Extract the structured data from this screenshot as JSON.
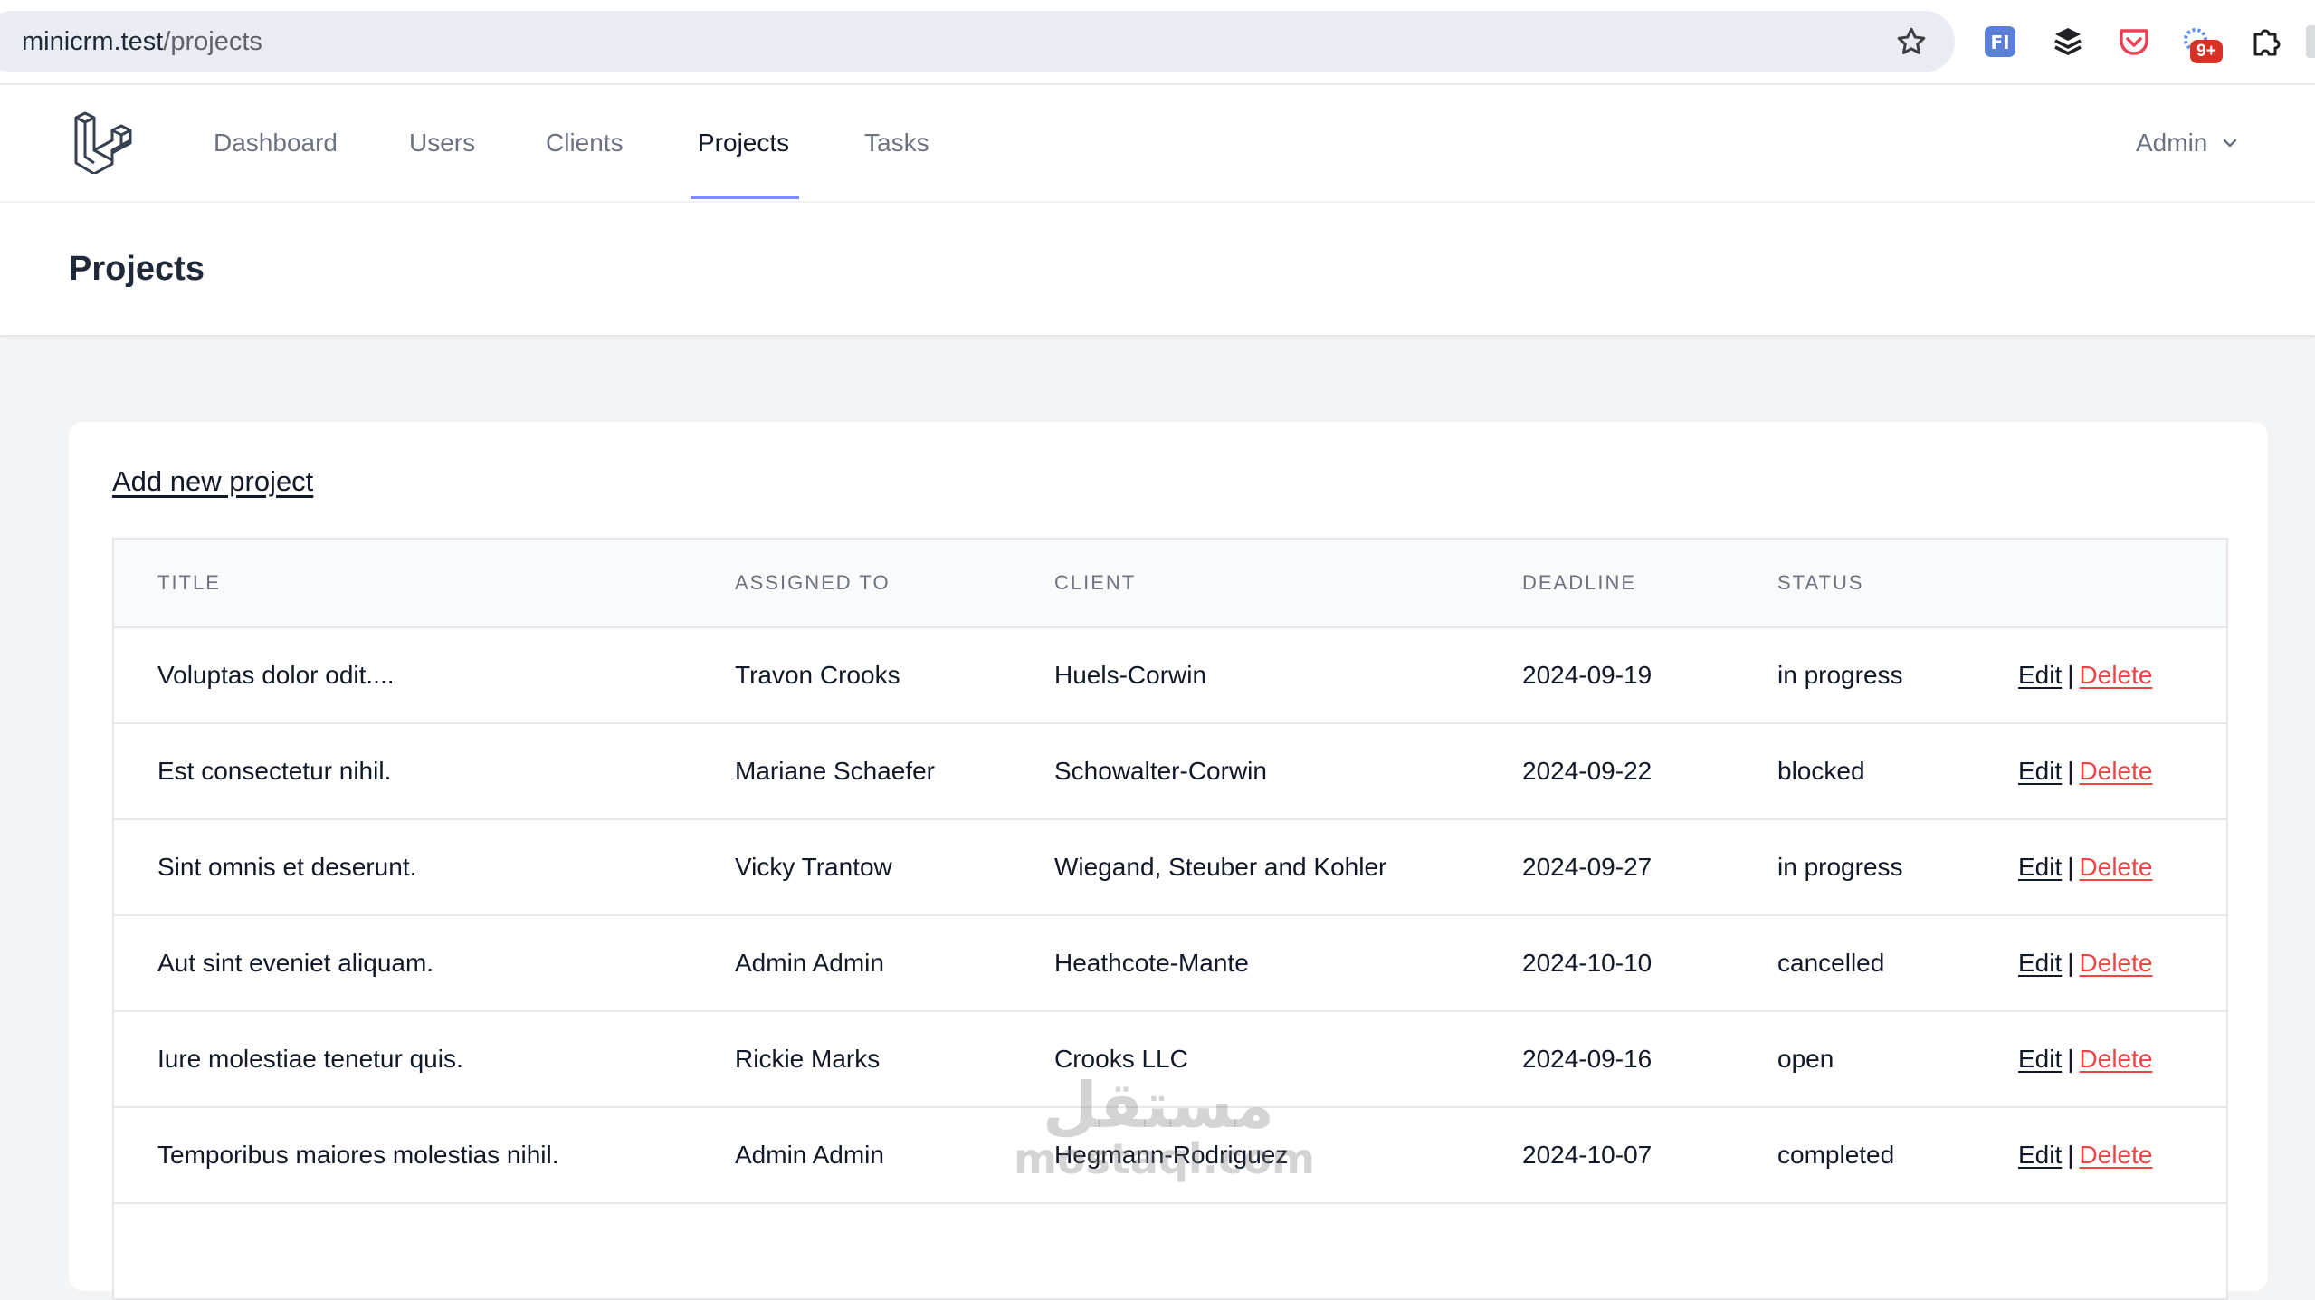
{
  "browser": {
    "url_host": "minicrm.test",
    "url_path": "/projects",
    "extension_badge": "9+"
  },
  "nav": {
    "items": [
      {
        "label": "Dashboard",
        "active": false
      },
      {
        "label": "Users",
        "active": false
      },
      {
        "label": "Clients",
        "active": false
      },
      {
        "label": "Projects",
        "active": true
      },
      {
        "label": "Tasks",
        "active": false
      }
    ],
    "user_menu": "Admin",
    "accent_color": "#818cf8"
  },
  "header": {
    "title": "Projects"
  },
  "main": {
    "add_link": "Add new project",
    "table": {
      "columns": [
        "TITLE",
        "ASSIGNED TO",
        "CLIENT",
        "DEADLINE",
        "STATUS"
      ],
      "edit_label": "Edit",
      "separator": "|",
      "delete_label": "Delete",
      "rows": [
        {
          "title": "Voluptas dolor odit....",
          "assigned_to": "Travon Crooks",
          "client": "Huels-Corwin",
          "deadline": "2024-09-19",
          "status": "in progress"
        },
        {
          "title": "Est consectetur nihil.",
          "assigned_to": "Mariane Schaefer",
          "client": "Schowalter-Corwin",
          "deadline": "2024-09-22",
          "status": "blocked"
        },
        {
          "title": "Sint omnis et deserunt.",
          "assigned_to": "Vicky Trantow",
          "client": "Wiegand, Steuber and Kohler",
          "deadline": "2024-09-27",
          "status": "in progress"
        },
        {
          "title": "Aut sint eveniet aliquam.",
          "assigned_to": "Admin Admin",
          "client": "Heathcote-Mante",
          "deadline": "2024-10-10",
          "status": "cancelled"
        },
        {
          "title": "Iure molestiae tenetur quis.",
          "assigned_to": "Rickie Marks",
          "client": "Crooks LLC",
          "deadline": "2024-09-16",
          "status": "open"
        },
        {
          "title": "Temporibus maiores molestias nihil.",
          "assigned_to": "Admin Admin",
          "client": "Hegmann-Rodriguez",
          "deadline": "2024-10-07",
          "status": "completed"
        }
      ]
    }
  },
  "watermark": {
    "arabic": "مستقل",
    "latin": "mostaql.com"
  },
  "colors": {
    "delete": "#ef4444",
    "page_bg": "#f3f4f6"
  }
}
